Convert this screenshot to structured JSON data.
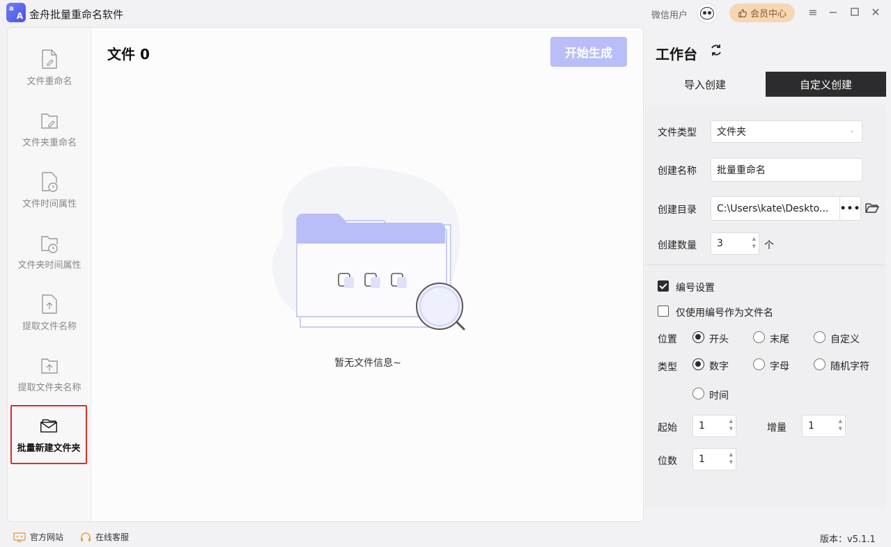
{
  "app": {
    "logo_top": "a",
    "logo_bottom": "A",
    "title": "金舟批量重命名软件",
    "user_label": "微信用户",
    "vip_label": "会员中心"
  },
  "nav": {
    "items": [
      {
        "label": "文件重命名",
        "icon": "file-edit-icon"
      },
      {
        "label": "文件夹重命名",
        "icon": "folder-edit-icon"
      },
      {
        "label": "文件时间属性",
        "icon": "file-clock-icon"
      },
      {
        "label": "文件夹时间属性",
        "icon": "folder-clock-icon"
      },
      {
        "label": "提取文件名称",
        "icon": "file-upload-icon"
      },
      {
        "label": "提取文件夹名称",
        "icon": "folder-upload-icon"
      },
      {
        "label": "批量新建文件夹",
        "icon": "new-folders-icon",
        "active": true
      }
    ]
  },
  "main": {
    "title_prefix": "文件",
    "file_count": "0",
    "start_label": "开始生成",
    "empty_text": "暂无文件信息~"
  },
  "workspace": {
    "title": "工作台",
    "tabs": [
      {
        "label": "导入创建",
        "active": false
      },
      {
        "label": "自定义创建",
        "active": true
      }
    ],
    "file_type_label": "文件类型",
    "file_type_value": "文件夹",
    "create_name_label": "创建名称",
    "create_name_value": "批量重命名",
    "create_dir_label": "创建目录",
    "create_dir_value": "C:\\Users\\kate\\Deskto...",
    "more_label": "•••",
    "create_count_label": "创建数量",
    "create_count_value": "3",
    "create_count_unit": "个",
    "numbering_label": "编号设置",
    "numbering_checked": true,
    "only_number_label": "仅使用编号作为文件名",
    "only_number_checked": false,
    "position_label": "位置",
    "position_options": [
      "开头",
      "末尾",
      "自定义"
    ],
    "position_selected": "开头",
    "type_label": "类型",
    "type_options": [
      "数字",
      "字母",
      "随机字符",
      "时间"
    ],
    "type_selected": "数字",
    "start_label": "起始",
    "start_value": "1",
    "increment_label": "增量",
    "increment_value": "1",
    "digits_label": "位数",
    "digits_value": "1"
  },
  "footer": {
    "website_label": "官方网站",
    "service_label": "在线客服",
    "version_prefix": "版本：",
    "version": "v5.1.1"
  },
  "colors": {
    "accent_dark": "#2c2c2e",
    "start_button": "#b9bef8",
    "active_border": "#e02a2a",
    "vip_bg": "#f6d7b5"
  }
}
